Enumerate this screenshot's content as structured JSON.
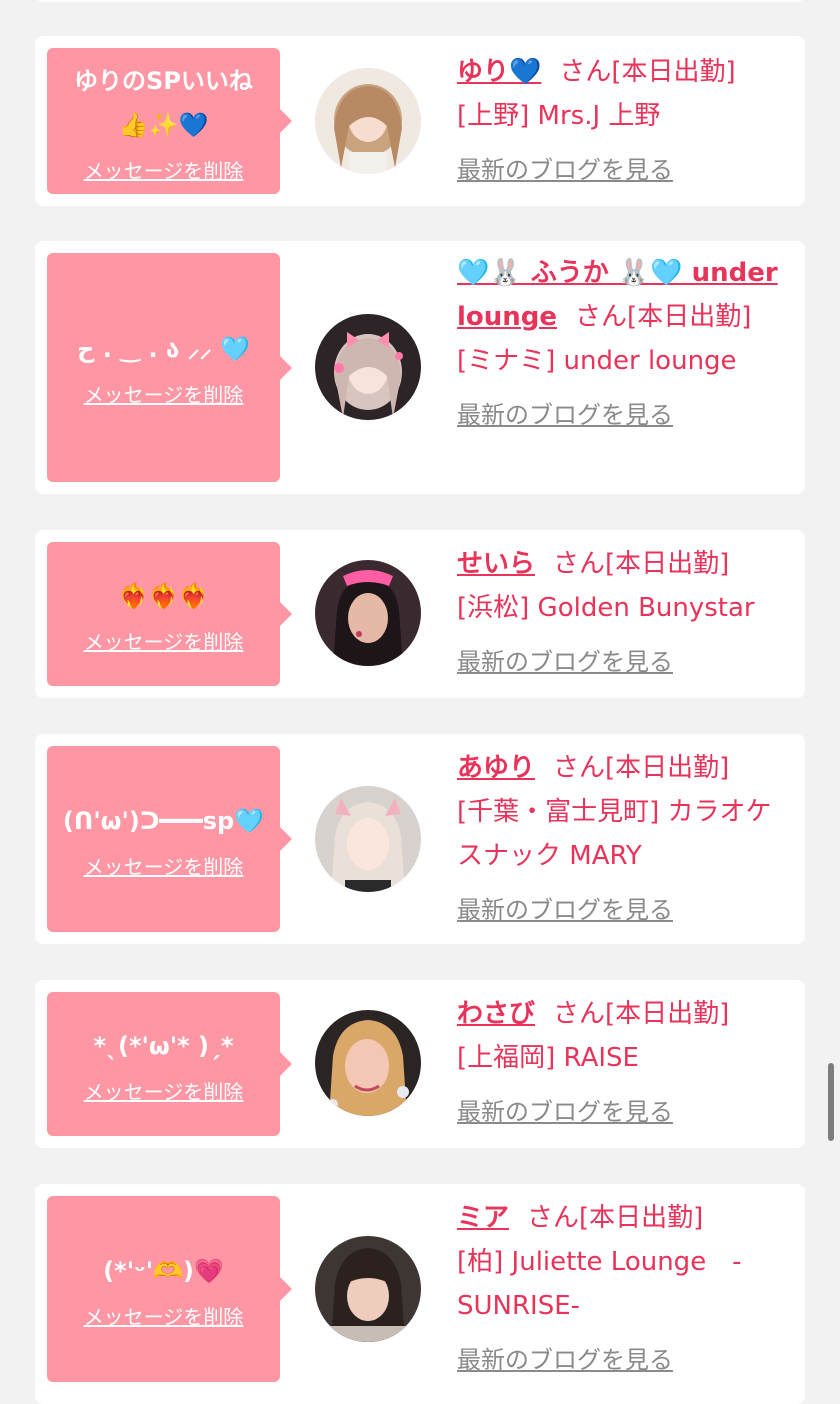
{
  "delete_label": "メッセージを削除",
  "blog_label": "最新のブログを見る",
  "cards": [
    {
      "message": "ゆりのSPいいね\n👍✨💙",
      "name": "ゆり💙",
      "status": "さん[本日出勤]",
      "place": "[上野] Mrs.J 上野",
      "avatar_icon": "woman-portrait-avatar"
    },
    {
      "message": "ح . ‿ . ა ⸝⸝ 🩵",
      "name": "🩵🐰 ふうか 🐰🩵 under lounge",
      "status": "さん[本日出勤]",
      "place": "[ミナミ] under lounge",
      "avatar_icon": "woman-portrait-avatar"
    },
    {
      "message": "❤️‍🔥❤️‍🔥❤️‍🔥",
      "name": "せいら",
      "status": "さん[本日出勤]",
      "place": "[浜松] Golden Bunystar",
      "avatar_icon": "woman-portrait-avatar"
    },
    {
      "message": "(ᑎ'ω')ᑐ━━━sp🩵",
      "name": "あゆり",
      "status": "さん[本日出勤]",
      "place": "[千葉・富士見町] カラオケスナック MARY",
      "avatar_icon": "woman-portrait-avatar"
    },
    {
      "message": "*ˎ(*'ω'* )ˏ*",
      "name": "わさび",
      "status": "さん[本日出勤]",
      "place": "[上福岡] RAISE",
      "avatar_icon": "woman-portrait-avatar"
    },
    {
      "message": "(*'ᵕ'🫶)💗",
      "name": "ミア",
      "status": "さん[本日出勤]",
      "place": "[柏] Juliette Lounge　-SUNRISE-",
      "avatar_icon": "woman-portrait-avatar"
    }
  ]
}
